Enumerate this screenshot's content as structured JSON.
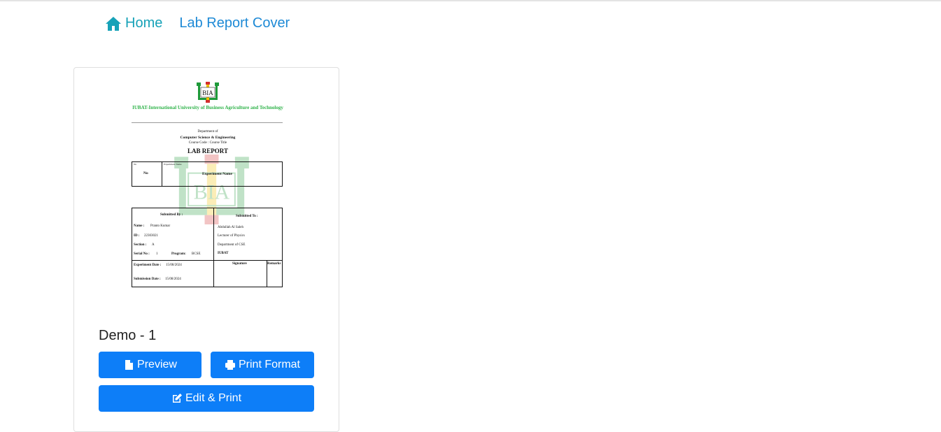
{
  "breadcrumb": {
    "home_label": "Home",
    "current_label": "Lab Report Cover"
  },
  "card": {
    "title": "Demo - 1",
    "buttons": {
      "preview": "Preview",
      "print_format": "Print Format",
      "edit_print": "Edit & Print"
    },
    "thumbnail": {
      "logo_text": "BIA",
      "university": "IUBAT-International University of Business Agriculture and Technology",
      "dept_of": "Department of",
      "department": "Computer Science & Engineering",
      "course": "Course Code : Course Title",
      "report_title": "LAB REPORT",
      "exp_no_header": "No",
      "exp_no_value": "No",
      "exp_name_header": "Experiment Name",
      "exp_name_value": "Experiment Name",
      "submitted_by": "Submitted By :",
      "submitted_to": "Submitted To :",
      "name_label": "Name :",
      "name_value": "Pranto Kumar",
      "id_label": "ID :",
      "id_value": "22303021",
      "section_label": "Section :",
      "section_value": "A",
      "serial_label": "Serial No :",
      "serial_value": "1",
      "program_label": "Program:",
      "program_value": "BCSE",
      "teacher_name": "Abdullah Al Saleh",
      "teacher_title": "Lecturer of Physics",
      "teacher_dept": "Department of CSE",
      "teacher_inst": "IUBAT",
      "exp_date_label": "Experiment Date :",
      "exp_date_value": "15/08/2024",
      "sub_date_label": "Submission Date :",
      "sub_date_value": "15/08/2024",
      "signature_label": "Signature",
      "remarks_label": "Remarks"
    }
  },
  "colors": {
    "primary": "#0d7ef8",
    "home": "#17a2b8",
    "link": "#1e8ad6",
    "logo_green": "#2fb34a",
    "logo_red": "#d32f2f"
  }
}
